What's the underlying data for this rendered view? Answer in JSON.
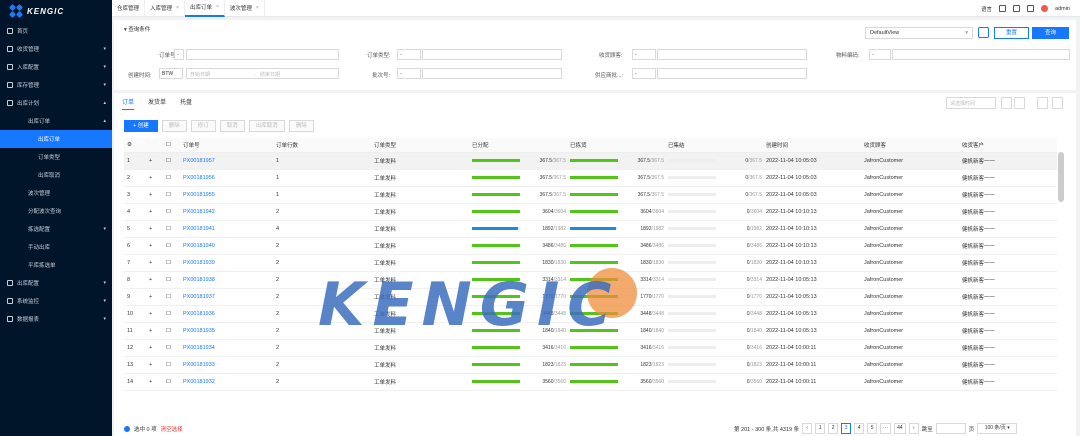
{
  "brand": {
    "name": "KENGIC"
  },
  "sidebar": {
    "items": [
      {
        "label": "首页",
        "level": 0
      },
      {
        "label": "收货管理",
        "level": 0,
        "arrow": "▾"
      },
      {
        "label": "入库配置",
        "level": 0,
        "arrow": "▾"
      },
      {
        "label": "库存管理",
        "level": 0,
        "arrow": "▾"
      },
      {
        "label": "出库计划",
        "level": 0,
        "arrow": "▴"
      },
      {
        "label": "出库订单",
        "level": 1,
        "arrow": "▴"
      },
      {
        "label": "出库订单",
        "level": 2,
        "selected": true
      },
      {
        "label": "订单类型",
        "level": 2
      },
      {
        "label": "出库取消",
        "level": 2
      },
      {
        "label": "波次管理",
        "level": 1
      },
      {
        "label": "分配波次查询",
        "level": 1
      },
      {
        "label": "拣选配置",
        "level": 1,
        "arrow": "▾"
      },
      {
        "label": "手动出库",
        "level": 1
      },
      {
        "label": "平库拣选单",
        "level": 1
      },
      {
        "label": "出库配置",
        "level": 0,
        "arrow": "▾"
      },
      {
        "label": "系统监控",
        "level": 0,
        "arrow": "▾"
      },
      {
        "label": "数据报表",
        "level": 0,
        "arrow": "▾"
      }
    ]
  },
  "tabs": [
    {
      "label": "仓库管理",
      "closable": false
    },
    {
      "label": "入库管理",
      "closable": true
    },
    {
      "label": "出库订单",
      "closable": true,
      "active": true
    },
    {
      "label": "波次管理",
      "closable": true
    }
  ],
  "topbar": {
    "lang": "语言",
    "user": "admin"
  },
  "query": {
    "title": "查询条件",
    "view": "DefaultView",
    "reset": "重置",
    "search": "查询",
    "fields": {
      "order_no": "订单号:",
      "order_type": "订单类型:",
      "receiver": "收货顾客:",
      "material_code": "物料编码:",
      "created": "创建时间:",
      "batch": "批次号:",
      "supplier": "供应商批...:"
    },
    "op_btw": "BTW",
    "op_dash": "-",
    "start_ph": "开始日期",
    "end_ph": "结束日期",
    "arrow": "→"
  },
  "subtabs": [
    "订单",
    "发货单",
    "托盘"
  ],
  "table_search_ph": "请选择时间",
  "actions": [
    "创建",
    "删除",
    "修订",
    "取消",
    "出库取消",
    "删除"
  ],
  "columns": [
    "订单号",
    "订单行数",
    "订单类型",
    "已分配",
    "已拣货",
    "已集结",
    "创建时间",
    "收货顾客",
    "收货客户"
  ],
  "rows": [
    {
      "n": "1",
      "id": "PX00181957",
      "lines": "1",
      "type": "工单发料",
      "a": "367.5",
      "at": "367.5",
      "p": "367.5",
      "pt": "367.5",
      "g": "0",
      "gt": "367.5",
      "t": "2022-11-04 10:05:03",
      "c": "JafronCustomer",
      "s": "健帆新客一一"
    },
    {
      "n": "2",
      "id": "PX00181956",
      "lines": "1",
      "type": "工单发料",
      "a": "367.5",
      "at": "367.5",
      "p": "367.5",
      "pt": "367.5",
      "g": "0",
      "gt": "367.5",
      "t": "2022-11-04 10:05:03",
      "c": "JafronCustomer",
      "s": "健帆新客一一"
    },
    {
      "n": "3",
      "id": "PX00181955",
      "lines": "1",
      "type": "工单发料",
      "a": "367.5",
      "at": "367.5",
      "p": "367.5",
      "pt": "367.5",
      "g": "0",
      "gt": "367.5",
      "t": "2022-11-04 10:05:03",
      "c": "JafronCustomer",
      "s": "健帆新客一一"
    },
    {
      "n": "4",
      "id": "PX00181942",
      "lines": "2",
      "type": "工单发料",
      "a": "3604",
      "at": "3604",
      "p": "3604",
      "pt": "3604",
      "g": "0",
      "gt": "3604",
      "t": "2022-11-04 10:10:13",
      "c": "JafronCustomer",
      "s": "健帆新客一一"
    },
    {
      "n": "5",
      "id": "PX00181941",
      "lines": "4",
      "type": "工单发料",
      "a": "1892",
      "at": "1982",
      "p": "1892",
      "pt": "1982",
      "g": "0",
      "gt": "1982",
      "t": "2022-11-04 10:10:13",
      "c": "JafronCustomer",
      "s": "健帆新客一一",
      "blue": true
    },
    {
      "n": "6",
      "id": "PX00181940",
      "lines": "2",
      "type": "工单发料",
      "a": "3486",
      "at": "3486",
      "p": "3486",
      "pt": "3486",
      "g": "0",
      "gt": "3486",
      "t": "2022-11-04 10:10:13",
      "c": "JafronCustomer",
      "s": "健帆新客一一"
    },
    {
      "n": "7",
      "id": "PX00181939",
      "lines": "2",
      "type": "工单发料",
      "a": "1830",
      "at": "1830",
      "p": "1830",
      "pt": "1830",
      "g": "0",
      "gt": "1830",
      "t": "2022-11-04 10:10:13",
      "c": "JafronCustomer",
      "s": "健帆新客一一"
    },
    {
      "n": "8",
      "id": "PX00181938",
      "lines": "2",
      "type": "工单发料",
      "a": "3314",
      "at": "3314",
      "p": "3314",
      "pt": "3314",
      "g": "0",
      "gt": "3314",
      "t": "2022-11-04 10:05:13",
      "c": "JafronCustomer",
      "s": "健帆新客一一"
    },
    {
      "n": "9",
      "id": "PX00181937",
      "lines": "2",
      "type": "工单发料",
      "a": "1770",
      "at": "1770",
      "p": "1770",
      "pt": "1770",
      "g": "0",
      "gt": "1770",
      "t": "2022-11-04 10:05:13",
      "c": "JafronCustomer",
      "s": "健帆新客一一"
    },
    {
      "n": "10",
      "id": "PX00181936",
      "lines": "2",
      "type": "工单发料",
      "a": "3448",
      "at": "3448",
      "p": "3448",
      "pt": "3448",
      "g": "0",
      "gt": "3448",
      "t": "2022-11-04 10:05:13",
      "c": "JafronCustomer",
      "s": "健帆新客一一"
    },
    {
      "n": "11",
      "id": "PX00181935",
      "lines": "2",
      "type": "工单发料",
      "a": "1840",
      "at": "1840",
      "p": "1840",
      "pt": "1840",
      "g": "0",
      "gt": "1840",
      "t": "2022-11-04 10:05:13",
      "c": "JafronCustomer",
      "s": "健帆新客一一"
    },
    {
      "n": "12",
      "id": "PX00181934",
      "lines": "2",
      "type": "工单发料",
      "a": "3416",
      "at": "3416",
      "p": "3416",
      "pt": "3416",
      "g": "0",
      "gt": "3416",
      "t": "2022-11-04 10:00:11",
      "c": "JafronCustomer",
      "s": "健帆新客一一"
    },
    {
      "n": "13",
      "id": "PX00181933",
      "lines": "2",
      "type": "工单发料",
      "a": "1823",
      "at": "1823",
      "p": "1823",
      "pt": "1823",
      "g": "0",
      "gt": "1823",
      "t": "2022-11-04 10:00:11",
      "c": "JafronCustomer",
      "s": "健帆新客一一"
    },
    {
      "n": "14",
      "id": "PX00181932",
      "lines": "2",
      "type": "工单发料",
      "a": "3560",
      "at": "3560",
      "p": "3560",
      "pt": "3560",
      "g": "0",
      "gt": "3560",
      "t": "2022-11-04 10:00:11",
      "c": "JafronCustomer",
      "s": "健帆新客一一"
    }
  ],
  "footer": {
    "selected": "选中 0 项",
    "clear": "清空选择",
    "summary": "第 201 - 300 条,共 4319 条",
    "pages": [
      "‹",
      "1",
      "2",
      "3",
      "4",
      "5",
      "···",
      "44",
      "›"
    ],
    "current": "3",
    "jump": "跳至",
    "page_unit": "页",
    "page_size": "100 条/页"
  },
  "watermark": "KENGIC",
  "colors": {
    "accent": "#1677ff",
    "green": "#52c41a",
    "blue_bar": "#1e88e5",
    "sidebar": "#001529"
  }
}
